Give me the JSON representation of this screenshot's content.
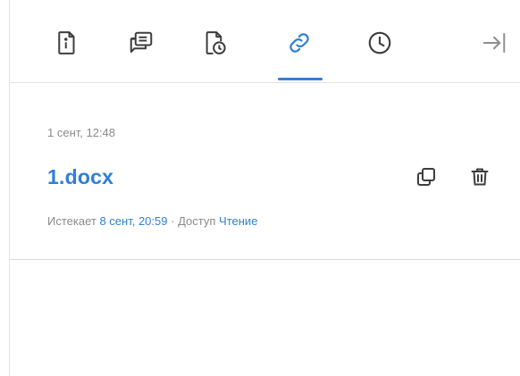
{
  "tabs": [
    {
      "name": "info",
      "icon": "file-info-icon",
      "active": false
    },
    {
      "name": "comments",
      "icon": "comments-icon",
      "active": false
    },
    {
      "name": "versions",
      "icon": "file-history-icon",
      "active": false
    },
    {
      "name": "shared-links",
      "icon": "link-icon",
      "active": true
    },
    {
      "name": "history",
      "icon": "clock-icon",
      "active": false
    }
  ],
  "toolbar": {
    "collapse_icon": "collapse-panel-icon"
  },
  "link_item": {
    "date": "1 сент, 12:48",
    "filename": "1.docx",
    "expires_label": "Истекает",
    "expires_value": "8 сент, 20:59",
    "separator": "·",
    "access_label": "Доступ",
    "access_value": "Чтение",
    "copy_icon": "copy-icon",
    "delete_icon": "trash-icon"
  },
  "colors": {
    "accent": "#2f7fd6",
    "icon": "#3d3d3d",
    "muted": "#8a8a8a"
  }
}
